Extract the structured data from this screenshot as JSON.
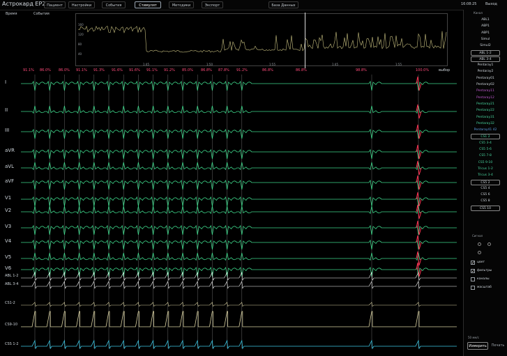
{
  "app": {
    "title": "Астрокард EP2"
  },
  "menu": [
    {
      "label": "Пациент",
      "active": false
    },
    {
      "label": "Настройки",
      "active": false
    },
    {
      "label": "События",
      "active": false
    },
    {
      "label": "Стимулят",
      "active": true
    },
    {
      "label": "Методики",
      "active": false
    },
    {
      "label": "Экспорт",
      "active": false
    },
    {
      "label": "База Данных",
      "active": false
    }
  ],
  "clock": "16:08:25",
  "exit_label": "Выход",
  "sub": {
    "time_label": "Время",
    "events_label": "События"
  },
  "trend": {
    "x_ticks": [
      "1:45",
      "1:50",
      "1:55",
      "1:45",
      "1:55"
    ],
    "y_ticks": [
      "160",
      "120",
      "80",
      "40"
    ]
  },
  "pcts": [
    "91.1%",
    "86.0%",
    "86.0%",
    "91.1%",
    "91.3%",
    "91.6%",
    "91.6%",
    "91.1%",
    "91.2%",
    "85.0%",
    "86.8%",
    "87.8%",
    "91.2%",
    "86.8%",
    "86.8%",
    "98.8%",
    "100.0%"
  ],
  "pct_legend": "выбор",
  "leads": [
    "I",
    "II",
    "III",
    "aVR",
    "aVL",
    "aVF",
    "V1",
    "V2",
    "V3",
    "V4",
    "V5",
    "V6",
    "ABL 1-2",
    "ABL 3-4",
    "CS1-2",
    "CS9-10",
    "CSS 1-2"
  ],
  "channels": [
    {
      "label": "ABL1",
      "color": "#cfd6dc",
      "box": false
    },
    {
      "label": "ABP1",
      "color": "#cfd6dc",
      "box": false
    },
    {
      "label": "ABP1",
      "color": "#cfd6dc",
      "box": false
    },
    {
      "label": "Simul",
      "color": "#cfd6dc",
      "box": false
    },
    {
      "label": "Simul2",
      "color": "#cfd6dc",
      "box": false
    },
    {
      "label": "ABL 1-2",
      "color": "#cfd6dc",
      "box": true
    },
    {
      "label": "ABL 3-4",
      "color": "#cfd6dc",
      "box": true
    },
    {
      "label": "Pentaray1",
      "color": "#cfd6dc",
      "box": false
    },
    {
      "label": "Pentaray2",
      "color": "#cfd6dc",
      "box": false
    },
    {
      "label": "Pentaray01",
      "color": "#cfd6dc",
      "box": false
    },
    {
      "label": "Pentaray02",
      "color": "#cfd6dc",
      "box": false
    },
    {
      "label": "Pentaray11",
      "color": "#c05ad0",
      "box": false
    },
    {
      "label": "Pentaray12",
      "color": "#c05ad0",
      "box": false
    },
    {
      "label": "Pentaray21",
      "color": "#4ad6a0",
      "box": false
    },
    {
      "label": "Pentaray22",
      "color": "#4ad6a0",
      "box": false
    },
    {
      "label": "Pentaray31",
      "color": "#4ad6a0",
      "box": false
    },
    {
      "label": "Pentaray32",
      "color": "#4ad6a0",
      "box": false
    },
    {
      "label": "Pentaray41 42",
      "color": "#5a9ae0",
      "box": false
    },
    {
      "label": "CS1 2",
      "color": "#4ad6a0",
      "box": true
    },
    {
      "label": "CS5 3-4",
      "color": "#4ad6a0",
      "box": false
    },
    {
      "label": "CS5 5-6",
      "color": "#4ad6a0",
      "box": false
    },
    {
      "label": "CS5 7-8",
      "color": "#4ad6a0",
      "box": false
    },
    {
      "label": "CS5 9-10",
      "color": "#4ad6a0",
      "box": false
    },
    {
      "label": "Tricus 1-2",
      "color": "#4ad6a0",
      "box": false
    },
    {
      "label": "Tricus 3-4",
      "color": "#4ad6a0",
      "box": false
    },
    {
      "label": "CS5 2",
      "color": "#cfd6dc",
      "box": true
    },
    {
      "label": "CS5 4",
      "color": "#cfd6dc",
      "box": false
    },
    {
      "label": "CS5 6",
      "color": "#cfd6dc",
      "box": false
    },
    {
      "label": "CS5 8",
      "color": "#cfd6dc",
      "box": false
    },
    {
      "label": "CS5 10",
      "color": "#cfd6dc",
      "box": true
    }
  ],
  "side": {
    "filter_label": "Канал",
    "lead_label": "Сигнал",
    "options": [
      {
        "label": "цвет",
        "checked": true
      },
      {
        "label": "фильтры",
        "checked": true
      },
      {
        "label": "каналы",
        "checked": false
      },
      {
        "label": "масштаб",
        "checked": false
      }
    ],
    "scale_label": "50 мм/с"
  },
  "bottom": {
    "measure_label": "Измерить",
    "print_label": "Печать"
  }
}
